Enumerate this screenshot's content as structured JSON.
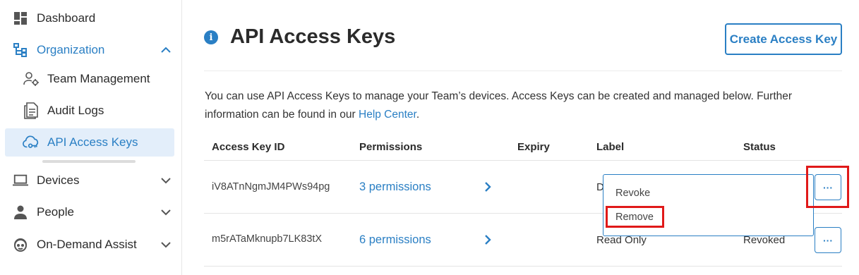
{
  "sidebar": {
    "items": [
      {
        "label": "Dashboard",
        "icon": "dashboard-icon"
      },
      {
        "label": "Organization",
        "icon": "organization-icon",
        "expanded": true
      },
      {
        "label": "Team Management",
        "icon": "team-management-icon"
      },
      {
        "label": "Audit Logs",
        "icon": "audit-logs-icon"
      },
      {
        "label": "API Access Keys",
        "icon": "cloud-key-icon",
        "active": true
      },
      {
        "label": "Devices",
        "icon": "laptop-icon"
      },
      {
        "label": "People",
        "icon": "person-icon"
      },
      {
        "label": "On-Demand Assist",
        "icon": "assist-icon"
      }
    ]
  },
  "header": {
    "title": "API Access Keys",
    "create_button": "Create Access Key"
  },
  "description": {
    "text_before": "You can use API Access Keys to manage your Team’s devices. Access Keys can be created and managed below. Further information can be found in our ",
    "link": "Help Center",
    "text_after": "."
  },
  "table": {
    "columns": [
      "Access Key ID",
      "Permissions",
      "Expiry",
      "Label",
      "Status"
    ],
    "rows": [
      {
        "key_id": "iV8ATnNgmJM4PWs94pg",
        "permissions": "3 permissions",
        "expiry": "",
        "label": "D",
        "status": ""
      },
      {
        "key_id": "m5rATaMknupb7LK83tX",
        "permissions": "6 permissions",
        "expiry": "",
        "label": "Read Only",
        "status": "Revoked"
      }
    ],
    "more_label": "···"
  },
  "dropdown": {
    "items": [
      "Revoke",
      "Remove"
    ]
  },
  "colors": {
    "accent": "#2a7fc4",
    "highlight": "#e01919",
    "active_bg": "#e3eefa"
  }
}
